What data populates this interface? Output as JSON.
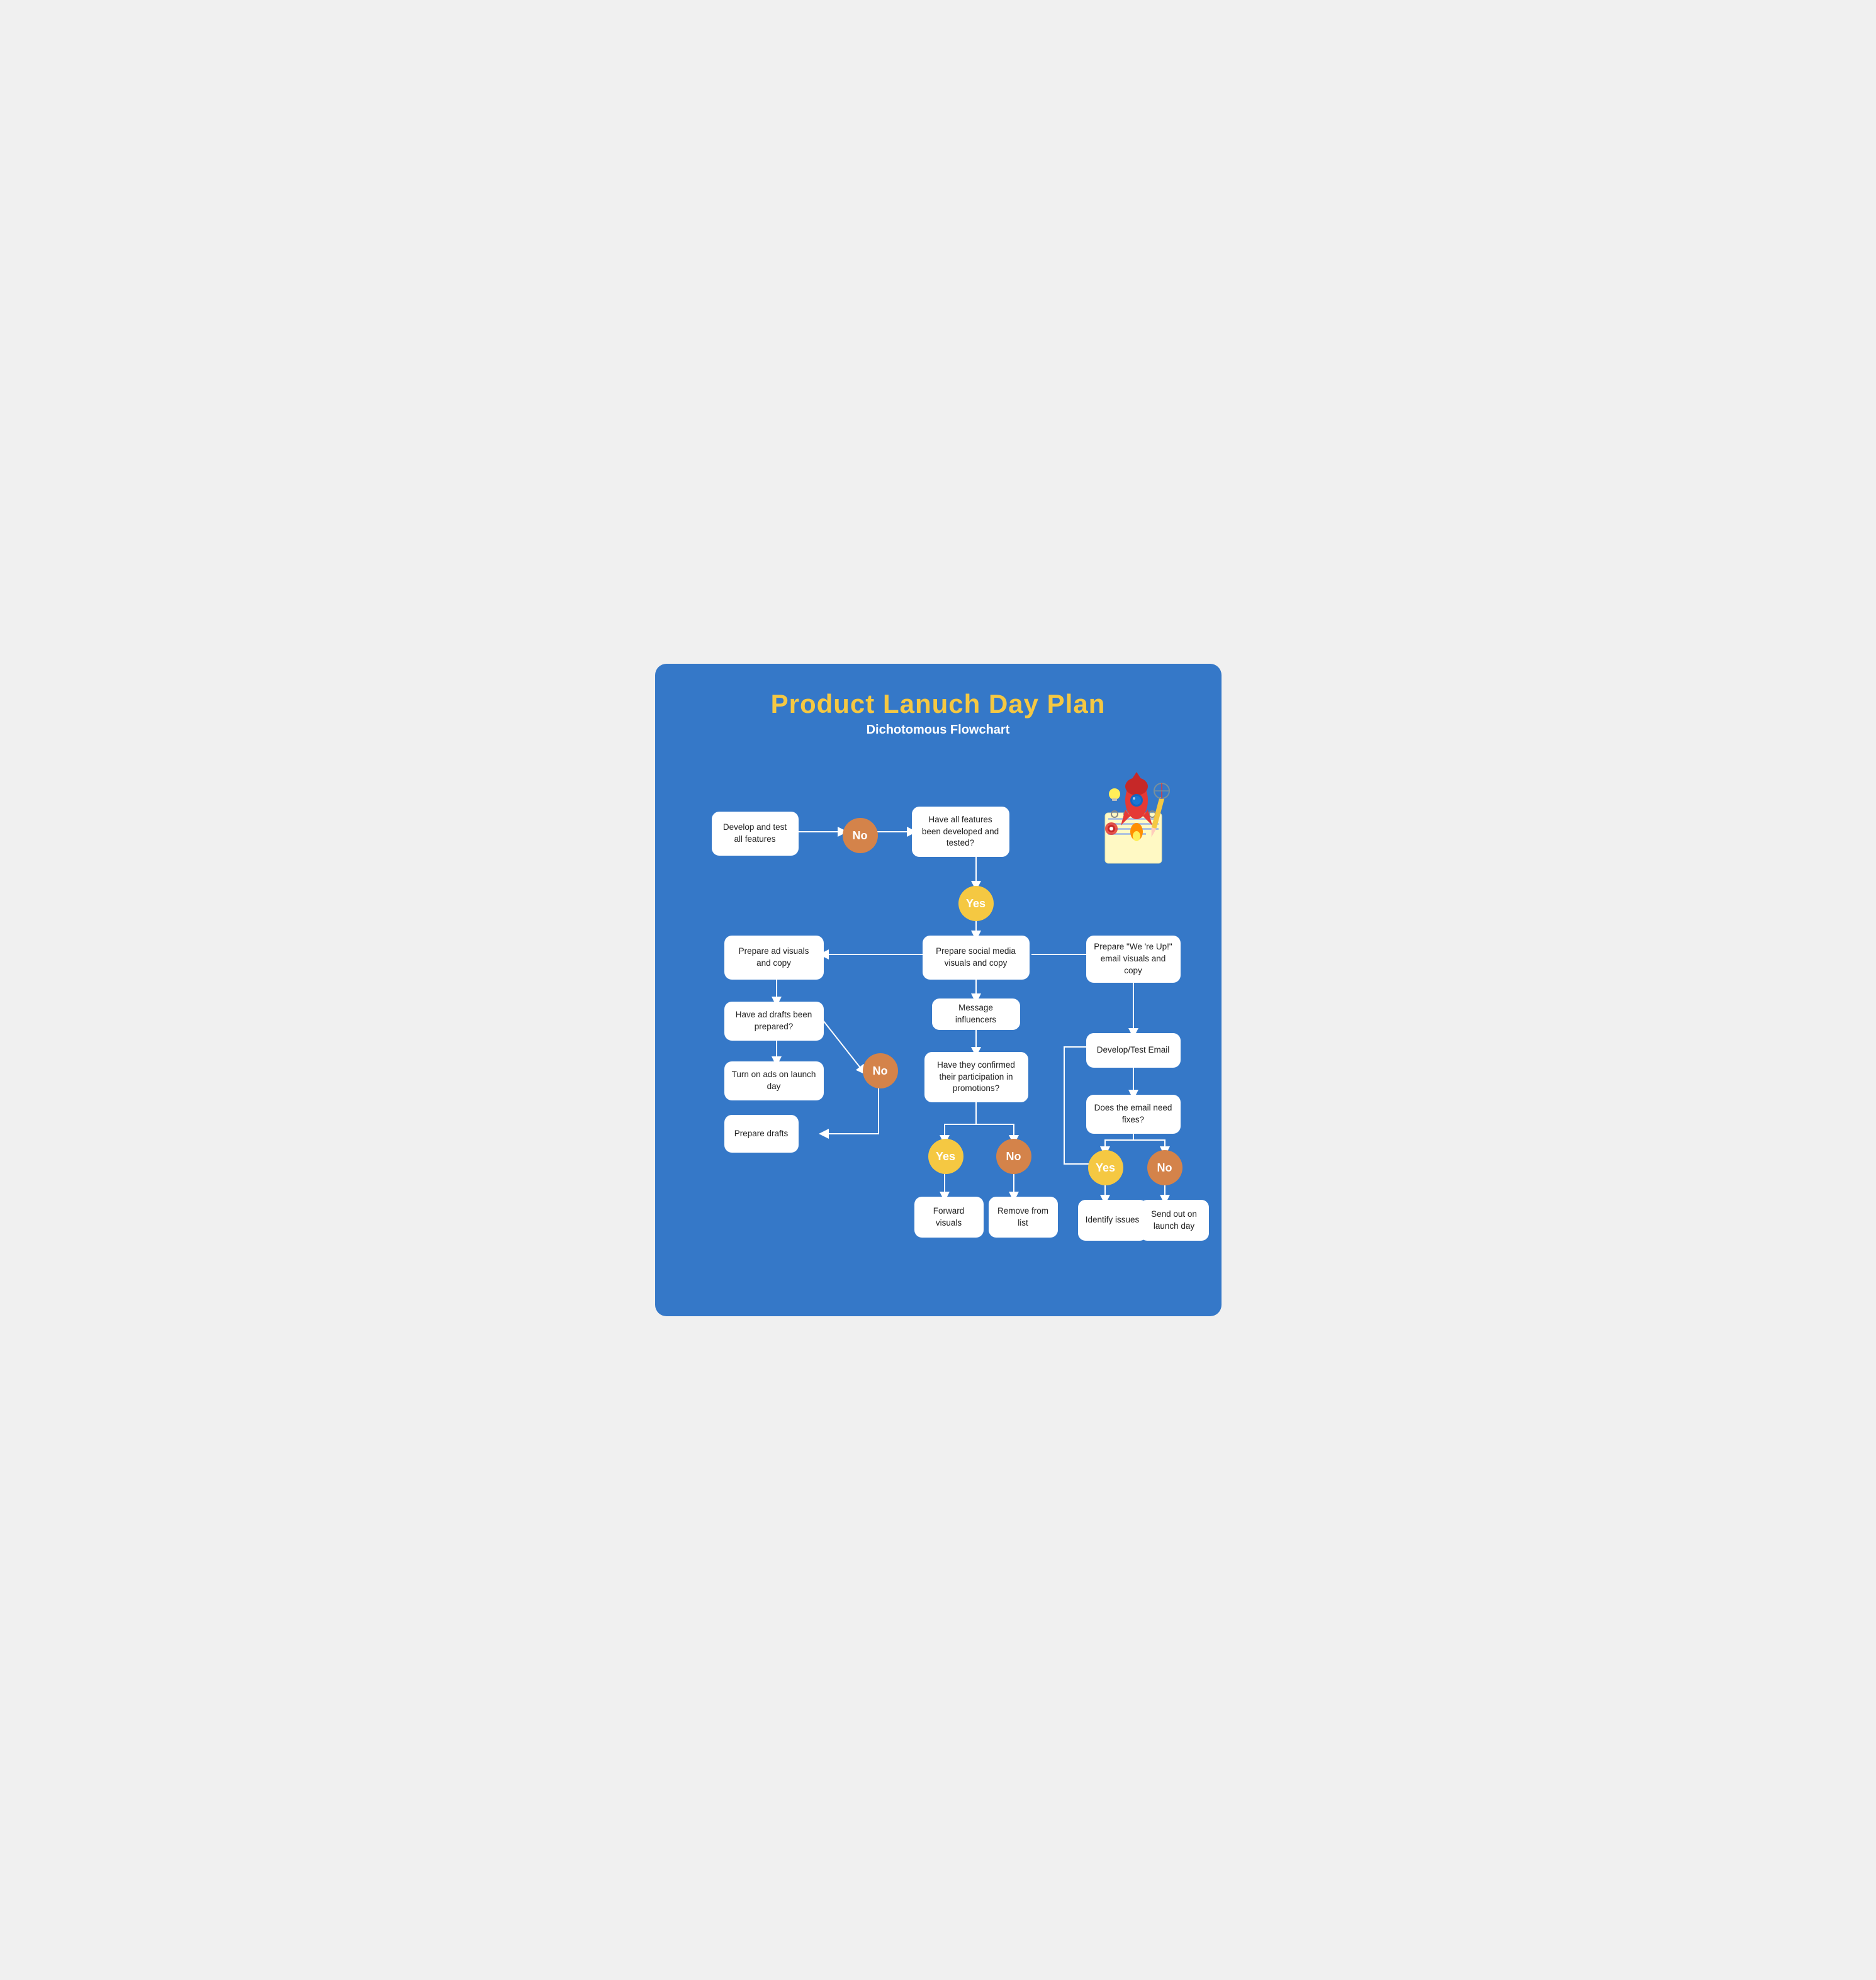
{
  "title": "Product Lanuch Day Plan",
  "subtitle": "Dichotomous Flowchart",
  "colors": {
    "background": "#3578c8",
    "title": "#f5c842",
    "subtitle": "#ffffff",
    "box_bg": "#ffffff",
    "circle_yellow": "#f5c842",
    "circle_orange": "#d4834a"
  },
  "boxes": {
    "develop": "Develop and test all features",
    "have_features": "Have all features been developed and tested?",
    "prepare_social": "Prepare social media visuals and copy",
    "prepare_ad": "Prepare ad visuals and copy",
    "prepare_email": "Prepare \"We 're Up!\" email visuals and copy",
    "have_ad_drafts": "Have ad drafts been prepared?",
    "message_influencers": "Message influencers",
    "develop_test_email": "Develop/Test Email",
    "turn_on_ads": "Turn on ads on launch day",
    "have_confirmed": "Have they confirmed their participation in promotions?",
    "email_need_fixes": "Does the email need fixes?",
    "prepare_drafts": "Prepare drafts",
    "forward_visuals": "Forward visuals",
    "remove_from_list": "Remove from list",
    "identify_issues": "Identify issues",
    "send_out": "Send out on launch day"
  },
  "circles": {
    "no1": "No",
    "yes1": "Yes",
    "no2": "No",
    "yes_conf": "Yes",
    "no_conf": "No",
    "yes_email": "Yes",
    "no_email": "No"
  }
}
